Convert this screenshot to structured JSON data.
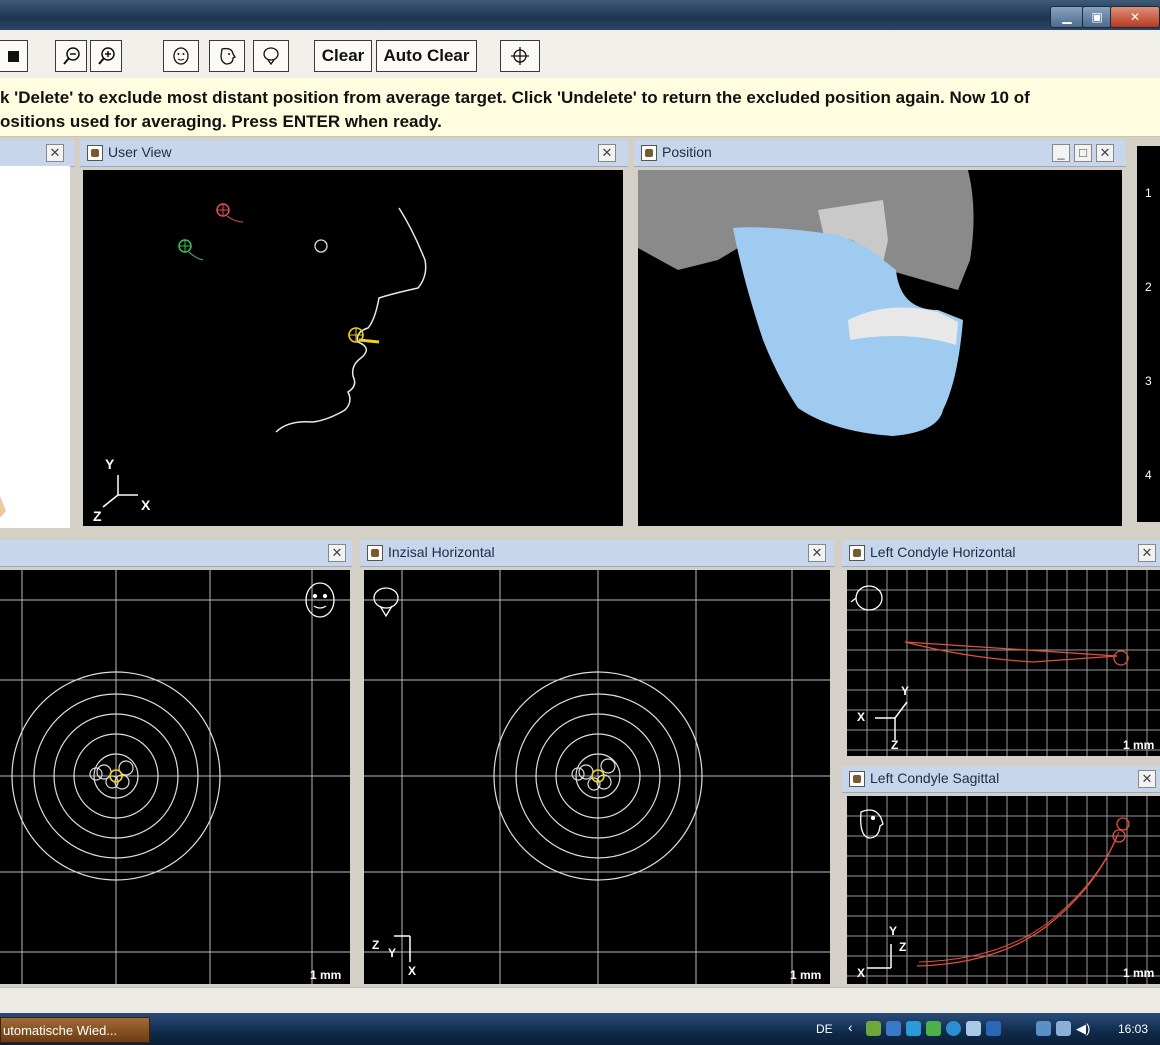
{
  "window": {
    "minimize": "▁",
    "maximize": "▣",
    "close": "✕"
  },
  "toolbar": {
    "clear_label": "Clear",
    "auto_clear_label": "Auto Clear"
  },
  "message": {
    "line1": "k 'Delete' to exclude most distant position from average target. Click 'Undelete' to return the excluded position again. Now 10 of",
    "line2": "ositions used for averaging. Press ENTER when ready."
  },
  "panels": {
    "user_view": {
      "title": "User View",
      "axis_y": "Y",
      "axis_x": "X",
      "axis_z": "Z"
    },
    "position": {
      "title": "Position"
    },
    "inzisal_horizontal": {
      "title": "Inzisal Horizontal",
      "scale": "1 mm",
      "axis_z": "Z",
      "axis_y": "Y",
      "axis_x": "X"
    },
    "left_panel_bottom": {
      "scale": "1 mm"
    },
    "left_condyle_horizontal": {
      "title": "Left Condyle Horizontal",
      "scale": "1 mm",
      "axis_y": "Y",
      "axis_x": "X",
      "axis_z": "Z"
    },
    "left_condyle_sagittal": {
      "title": "Left Condyle Sagittal",
      "scale": "1 mm",
      "axis_y": "Y",
      "axis_z": "Z",
      "axis_x": "X"
    }
  },
  "side_strip": {
    "items": [
      "1",
      "2",
      "3",
      "4"
    ]
  },
  "taskbar": {
    "task_label": "utomatische Wied...",
    "lang": "DE",
    "clock": "16:03"
  },
  "colors": {
    "panel_title_bg": "#c7d6ea",
    "viewport_bg": "#000000",
    "trajectory": "#e0503a",
    "marker_yellow": "#f0d020",
    "marker_green": "#3ac060"
  }
}
